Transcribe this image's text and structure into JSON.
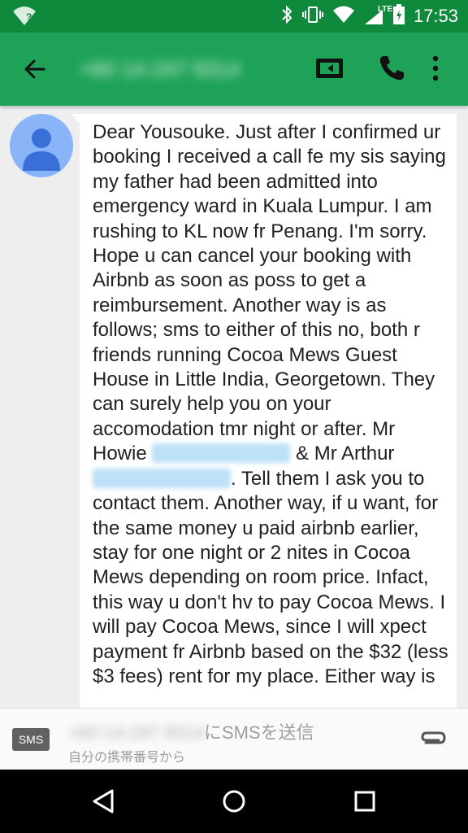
{
  "status_bar": {
    "time": "17:53",
    "network_label": "LTE",
    "wifi_badge": "?"
  },
  "toolbar": {
    "contact": "+60 14-247 9314",
    "icons": [
      "back-arrow-icon",
      "video-call-icon",
      "phone-icon",
      "more-vert-icon"
    ]
  },
  "message": {
    "part1": "Dear Yousouke. Just after I confirmed ur booking I received a call fe my sis saying my father had been admitted into emergency ward in Kuala Lumpur. I am rushing to KL now fr Penang. I'm sorry. Hope u can cancel your booking with Airbnb as soon as poss to get a reimbursement. Another way is as follows;  sms to either of this no, both r friends running Cocoa Mews Guest House in Little India, Georgetown. They can surely help you on your accomodation tmr night or  after. Mr Howie",
    "part2": " & Mr Arthur",
    "part3": ". Tell them I ask you to contact  them. Another way,  if u want, for the same money u paid airbnb earlier,  stay for one night  or 2 nites in Cocoa Mews depending on room price. Infact,  this way u don't hv to pay Cocoa Mews. I will pay Cocoa Mews, since I will xpect  payment fr Airbnb based on the $32 (less $3 fees) rent for my place.  Either way is"
  },
  "compose": {
    "badge": "SMS",
    "number": "+60 14-247 9314",
    "hint_suffix": "にSMSを送信",
    "subhint": "自分の携帯番号から"
  },
  "colors": {
    "status_bar": "#0f8a3c",
    "toolbar": "#1ea257",
    "chat_bg": "#eeeeee",
    "avatar": "#8ab4f8"
  }
}
